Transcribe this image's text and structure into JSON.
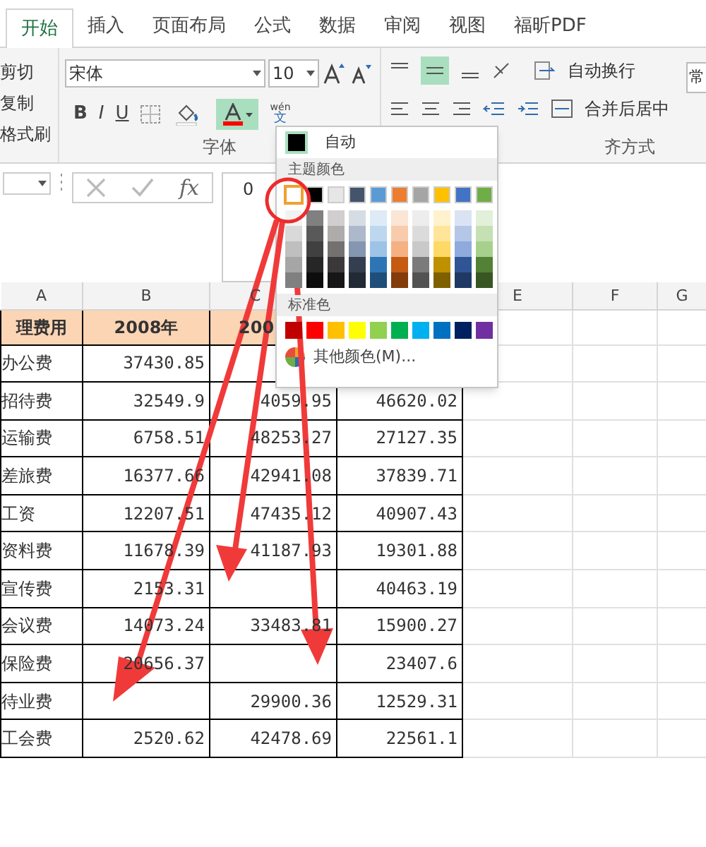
{
  "tabs": [
    {
      "label": "开始",
      "selected": true
    },
    {
      "label": "插入",
      "selected": false
    },
    {
      "label": "页面布局",
      "selected": false
    },
    {
      "label": "公式",
      "selected": false
    },
    {
      "label": "数据",
      "selected": false
    },
    {
      "label": "审阅",
      "selected": false
    },
    {
      "label": "视图",
      "selected": false
    },
    {
      "label": "福昕PDF",
      "selected": false
    }
  ],
  "clipboard": [
    "剪切",
    "复制",
    "格式刷"
  ],
  "font": {
    "styles": [
      "B",
      "I",
      "U"
    ],
    "name": "宋体",
    "size": "10",
    "group_label": "字体",
    "font_color_pressed": true,
    "phonetic_top": "wén",
    "phonetic_bottom": "文"
  },
  "alignment": {
    "wrap_text": "自动换行",
    "merge_center": "合并后居中",
    "group_label": "齐方式"
  },
  "number_format": {
    "value": "常"
  },
  "formula_bar": {
    "function_label": "fx",
    "content": "0"
  },
  "sheet": {
    "columns": [
      "A",
      "B",
      "C",
      "E",
      "F",
      "G"
    ],
    "header": [
      "理费用",
      "2008年",
      "200"
    ],
    "rows": [
      [
        "办公费",
        "37430.85",
        null,
        null
      ],
      [
        "招待费",
        "32549.9",
        "4059.95",
        "46620.02"
      ],
      [
        "运输费",
        "6758.51",
        "48253.27",
        "27127.35"
      ],
      [
        "差旅费",
        "16377.66",
        "42941.08",
        "37839.71"
      ],
      [
        "工资",
        "12207.51",
        "47435.12",
        "40907.43"
      ],
      [
        "资料费",
        "11678.39",
        "41187.93",
        "19301.88"
      ],
      [
        "宣传费",
        "2153.31",
        null,
        "40463.19"
      ],
      [
        "会议费",
        "14073.24",
        "33483.81",
        "15900.27"
      ],
      [
        "保险费",
        "20656.37",
        null,
        "23407.6"
      ],
      [
        "待业费",
        null,
        "29900.36",
        "12529.31"
      ],
      [
        "工会费",
        "2520.62",
        "42478.69",
        "22561.1"
      ]
    ]
  },
  "color_menu": {
    "automatic": "自动",
    "theme_label": "主题颜色",
    "standard_label": "标准色",
    "more": "其他颜色(M)...",
    "theme": [
      {
        "color": "#ffffff",
        "selected": true
      },
      {
        "color": "#000000",
        "selected": false
      },
      {
        "color": "#e7e6e6",
        "selected": false
      },
      {
        "color": "#44546a",
        "selected": false
      },
      {
        "color": "#5b9bd5",
        "selected": false
      },
      {
        "color": "#ed7d31",
        "selected": false
      },
      {
        "color": "#a5a5a5",
        "selected": false
      },
      {
        "color": "#ffc000",
        "selected": false
      },
      {
        "color": "#4472c4",
        "selected": false
      },
      {
        "color": "#70ad47",
        "selected": false
      }
    ],
    "shades": [
      {
        "swatches": [
          {
            "color": "#f2f2f2"
          },
          {
            "color": "#d9d9d9"
          },
          {
            "color": "#bfbfbf"
          },
          {
            "color": "#a6a6a6"
          },
          {
            "color": "#808080"
          }
        ]
      },
      {
        "swatches": [
          {
            "color": "#808080"
          },
          {
            "color": "#595959"
          },
          {
            "color": "#404040"
          },
          {
            "color": "#262626"
          },
          {
            "color": "#0d0d0d"
          }
        ]
      },
      {
        "swatches": [
          {
            "color": "#d0cece"
          },
          {
            "color": "#aeabab"
          },
          {
            "color": "#757171"
          },
          {
            "color": "#3a3838"
          },
          {
            "color": "#171616"
          }
        ]
      },
      {
        "swatches": [
          {
            "color": "#d6dce4"
          },
          {
            "color": "#adb9ca"
          },
          {
            "color": "#8496b0"
          },
          {
            "color": "#333f4f"
          },
          {
            "color": "#222a35"
          }
        ]
      },
      {
        "swatches": [
          {
            "color": "#deebf6"
          },
          {
            "color": "#bdd7ee"
          },
          {
            "color": "#9dc3e6"
          },
          {
            "color": "#2e75b5"
          },
          {
            "color": "#1f4e79"
          }
        ]
      },
      {
        "swatches": [
          {
            "color": "#fbe5d5"
          },
          {
            "color": "#f7cbac"
          },
          {
            "color": "#f4b183"
          },
          {
            "color": "#c55a11"
          },
          {
            "color": "#843c0b"
          }
        ]
      },
      {
        "swatches": [
          {
            "color": "#ededed"
          },
          {
            "color": "#dbdbdb"
          },
          {
            "color": "#c9c9c9"
          },
          {
            "color": "#7b7b7b"
          },
          {
            "color": "#525252"
          }
        ]
      },
      {
        "swatches": [
          {
            "color": "#fff2cc"
          },
          {
            "color": "#fee599"
          },
          {
            "color": "#ffd965"
          },
          {
            "color": "#bf9000"
          },
          {
            "color": "#7f6000"
          }
        ]
      },
      {
        "swatches": [
          {
            "color": "#dae3f3"
          },
          {
            "color": "#b4c7e7"
          },
          {
            "color": "#8faadc"
          },
          {
            "color": "#2f5597"
          },
          {
            "color": "#203864"
          }
        ]
      },
      {
        "swatches": [
          {
            "color": "#e2efd9"
          },
          {
            "color": "#c5e0b3"
          },
          {
            "color": "#a8d08d"
          },
          {
            "color": "#538135"
          },
          {
            "color": "#375623"
          }
        ]
      }
    ],
    "standard": [
      {
        "color": "#c00000"
      },
      {
        "color": "#ff0000"
      },
      {
        "color": "#ffc000"
      },
      {
        "color": "#ffff00"
      },
      {
        "color": "#92d050"
      },
      {
        "color": "#00b050"
      },
      {
        "color": "#00b0f0"
      },
      {
        "color": "#0070c0"
      },
      {
        "color": "#002060"
      },
      {
        "color": "#7030a0"
      }
    ]
  }
}
